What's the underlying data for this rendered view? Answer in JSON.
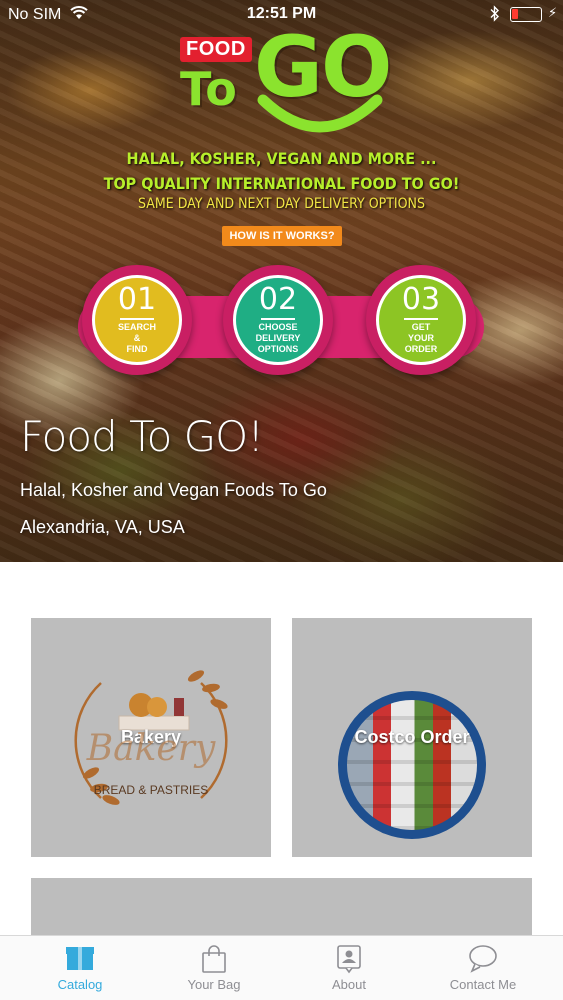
{
  "status_bar": {
    "carrier": "No SIM",
    "time": "12:51 PM"
  },
  "hero": {
    "logo": {
      "food": "FOOD",
      "to": "To",
      "go": "GO"
    },
    "tagline_1": "HALAL, KOSHER, VEGAN AND MORE ...",
    "tagline_2": "TOP QUALITY INTERNATIONAL FOOD TO GO!",
    "tagline_3": "SAME DAY AND NEXT DAY DELIVERY OPTIONS",
    "how_button": "HOW IS IT WORKS?",
    "steps": [
      {
        "number": "01",
        "label": "SEARCH\n&\nFIND",
        "color": "#e1bc1f"
      },
      {
        "number": "02",
        "label": "CHOOSE\nDELIVERY\nOPTIONS",
        "color": "#1fae84"
      },
      {
        "number": "03",
        "label": "GET\nYOUR\nORDER",
        "color": "#8dc524"
      }
    ],
    "title": "Food To GO!",
    "subtitle": "Halal, Kosher and Vegan Foods To Go",
    "location": "Alexandria, VA, USA"
  },
  "catalog": {
    "tiles": [
      {
        "label": "Bakery",
        "logo_text": "Bakery",
        "logo_subtext": "BREAD & PASTRIES"
      },
      {
        "label": "Costco Order"
      }
    ]
  },
  "tab_bar": {
    "active_color": "#34aadc",
    "tabs": [
      {
        "label": "Catalog",
        "icon": "catalog-box-icon"
      },
      {
        "label": "Your Bag",
        "icon": "bag-icon"
      },
      {
        "label": "About",
        "icon": "about-person-icon"
      },
      {
        "label": "Contact Me",
        "icon": "chat-bubble-icon"
      }
    ]
  }
}
